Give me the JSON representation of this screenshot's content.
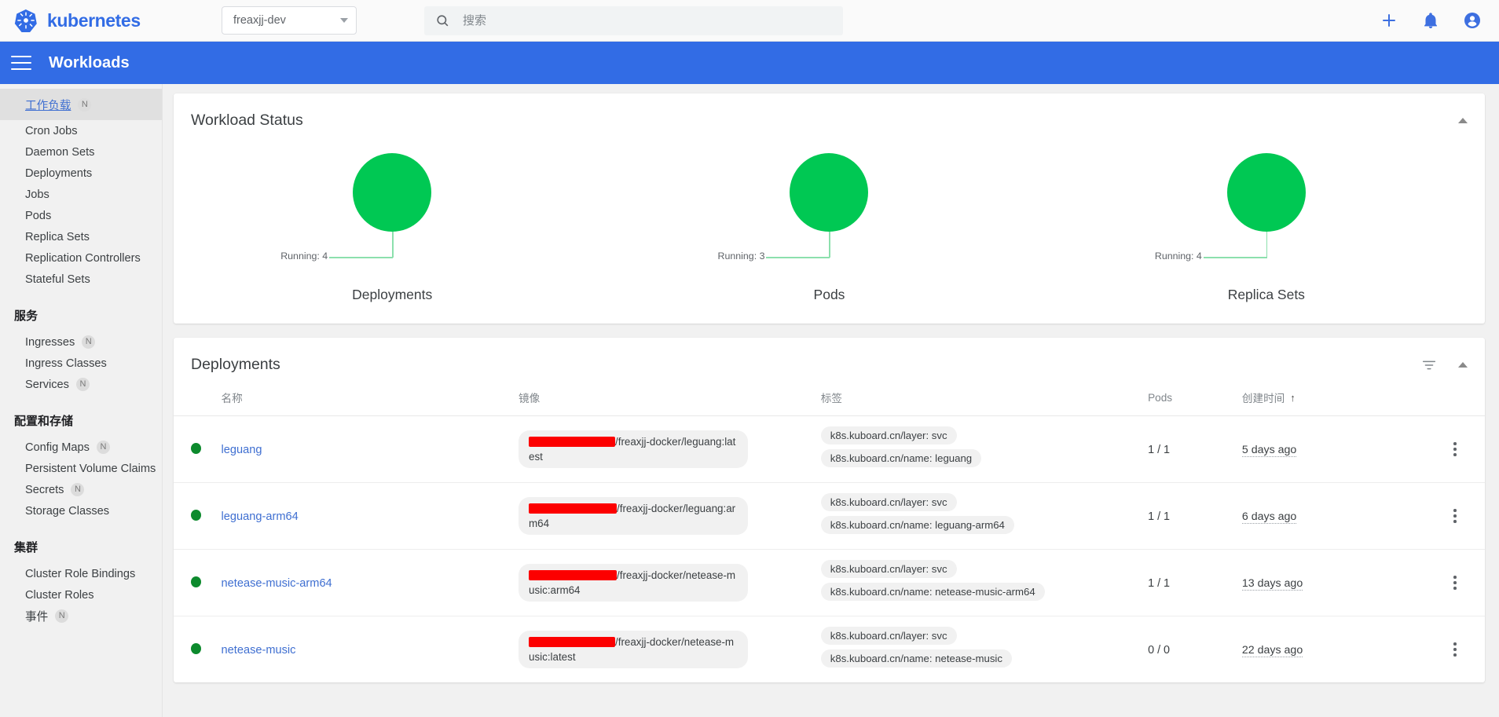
{
  "topbar": {
    "brand": "kubernetes",
    "brand_color": "#326ce5",
    "namespace_selected": "freaxjj-dev",
    "search_placeholder": "搜索",
    "search_value": "",
    "icons": [
      "plus-icon",
      "bell-icon",
      "account-icon"
    ]
  },
  "header": {
    "title": "Workloads"
  },
  "sidebar": {
    "sections": [
      {
        "group": null,
        "items": [
          {
            "label": "工作负载",
            "badge": "N",
            "active": true
          },
          {
            "label": "Cron Jobs",
            "badge": null,
            "active": false
          },
          {
            "label": "Daemon Sets",
            "badge": null,
            "active": false
          },
          {
            "label": "Deployments",
            "badge": null,
            "active": false
          },
          {
            "label": "Jobs",
            "badge": null,
            "active": false
          },
          {
            "label": "Pods",
            "badge": null,
            "active": false
          },
          {
            "label": "Replica Sets",
            "badge": null,
            "active": false
          },
          {
            "label": "Replication Controllers",
            "badge": null,
            "active": false
          },
          {
            "label": "Stateful Sets",
            "badge": null,
            "active": false
          }
        ]
      },
      {
        "group": "服务",
        "items": [
          {
            "label": "Ingresses",
            "badge": "N",
            "active": false
          },
          {
            "label": "Ingress Classes",
            "badge": null,
            "active": false
          },
          {
            "label": "Services",
            "badge": "N",
            "active": false
          }
        ]
      },
      {
        "group": "配置和存储",
        "items": [
          {
            "label": "Config Maps",
            "badge": "N",
            "active": false
          },
          {
            "label": "Persistent Volume Claims",
            "badge": "N",
            "active": false
          },
          {
            "label": "Secrets",
            "badge": "N",
            "active": false
          },
          {
            "label": "Storage Classes",
            "badge": null,
            "active": false
          }
        ]
      },
      {
        "group": "集群",
        "items": [
          {
            "label": "Cluster Role Bindings",
            "badge": null,
            "active": false
          },
          {
            "label": "Cluster Roles",
            "badge": null,
            "active": false
          },
          {
            "label": "事件",
            "badge": "N",
            "active": false
          }
        ]
      }
    ]
  },
  "workload_status": {
    "title": "Workload Status",
    "collapse_icon": "chevron-up-icon"
  },
  "chart_data": [
    {
      "type": "pie",
      "title": "Deployments",
      "categories": [
        "Running"
      ],
      "values": [
        4
      ],
      "labels": [
        "Running: 4"
      ],
      "colors": [
        "#00c853"
      ],
      "legend": "leader-line-left"
    },
    {
      "type": "pie",
      "title": "Pods",
      "categories": [
        "Running"
      ],
      "values": [
        3
      ],
      "labels": [
        "Running: 3"
      ],
      "colors": [
        "#00c853"
      ],
      "legend": "leader-line-left"
    },
    {
      "type": "pie",
      "title": "Replica Sets",
      "categories": [
        "Running"
      ],
      "values": [
        4
      ],
      "labels": [
        "Running: 4"
      ],
      "colors": [
        "#00c853"
      ],
      "legend": "leader-line-left"
    }
  ],
  "deployments": {
    "title": "Deployments",
    "filter_icon": "filter-icon",
    "collapse_icon": "chevron-up-icon",
    "columns": {
      "status": "",
      "name": "名称",
      "image": "镜像",
      "labels": "标签",
      "pods": "Pods",
      "created": "创建时间",
      "sort_arrow": "↑",
      "menu": ""
    },
    "rows": [
      {
        "status": "green",
        "name": "leguang",
        "image_redacted_width": 110,
        "image_suffix": "/freaxjj-docker/leguang:latest",
        "labels": [
          "k8s.kuboard.cn/layer: svc",
          "k8s.kuboard.cn/name: leguang"
        ],
        "pods": "1 / 1",
        "created": "5 days ago"
      },
      {
        "status": "green",
        "name": "leguang-arm64",
        "image_redacted_width": 112,
        "image_suffix": "/freaxjj-docker/leguang:arm64",
        "labels": [
          "k8s.kuboard.cn/layer: svc",
          "k8s.kuboard.cn/name: leguang-arm64"
        ],
        "pods": "1 / 1",
        "created": "6 days ago"
      },
      {
        "status": "green",
        "name": "netease-music-arm64",
        "image_redacted_width": 112,
        "image_suffix": "/freaxjj-docker/netease-music:arm64",
        "labels": [
          "k8s.kuboard.cn/layer: svc",
          "k8s.kuboard.cn/name: netease-music-arm64"
        ],
        "pods": "1 / 1",
        "created": "13 days ago"
      },
      {
        "status": "green",
        "name": "netease-music",
        "image_redacted_width": 110,
        "image_suffix": "/freaxjj-docker/netease-music:latest",
        "labels": [
          "k8s.kuboard.cn/layer: svc",
          "k8s.kuboard.cn/name: netease-music"
        ],
        "pods": "0 / 0",
        "created": "22 days ago"
      }
    ]
  }
}
